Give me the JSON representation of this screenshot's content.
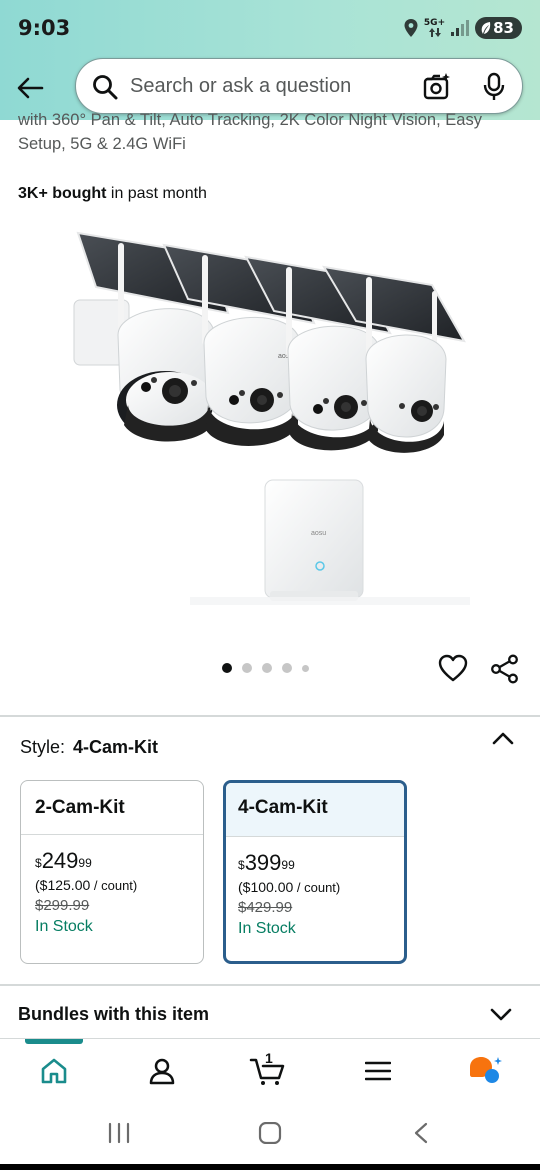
{
  "status_bar": {
    "time": "9:03",
    "network": "5G+",
    "battery": "83"
  },
  "search": {
    "placeholder": "Search or ask a question"
  },
  "product": {
    "title_line1": "with 360° Pan & Tilt, Auto Tracking, 2K Color Night Vision, Easy",
    "title_line2": "Setup, 5G & 2.4G WiFi",
    "bought_bold": "3K+ bought",
    "bought_rest": " in past month",
    "brand_on_device": "aosu"
  },
  "carousel": {
    "dot_count": 5,
    "active_index": 0
  },
  "style_selector": {
    "label": "Style:",
    "selected": "4-Cam-Kit",
    "options": [
      {
        "name": "2-Cam-Kit",
        "price_whole": "249",
        "price_fraction": "99",
        "currency": "$",
        "unit_price": "($125.00",
        "unit_suffix": " / count)",
        "list_price": "$299.99",
        "availability": "In Stock",
        "selected": false
      },
      {
        "name": "4-Cam-Kit",
        "price_whole": "399",
        "price_fraction": "99",
        "currency": "$",
        "unit_price": "($100.00",
        "unit_suffix": " / count)",
        "list_price": "$429.99",
        "availability": "In Stock",
        "selected": true
      }
    ]
  },
  "bundles": {
    "label": "Bundles with this item"
  },
  "bottom_nav": {
    "items": [
      "home-icon",
      "account-icon",
      "cart-icon",
      "menu-icon",
      "rufus-icon"
    ],
    "cart_count": "1"
  },
  "colors": {
    "header_gradient_start": "#8fd9d3",
    "header_gradient_end": "#b5e6d1",
    "selected_border": "#2b5e8c",
    "in_stock": "#067d62",
    "nav_accent": "#1a8c8c",
    "rufus_orange": "#f7730e",
    "rufus_blue": "#1e88e5"
  }
}
